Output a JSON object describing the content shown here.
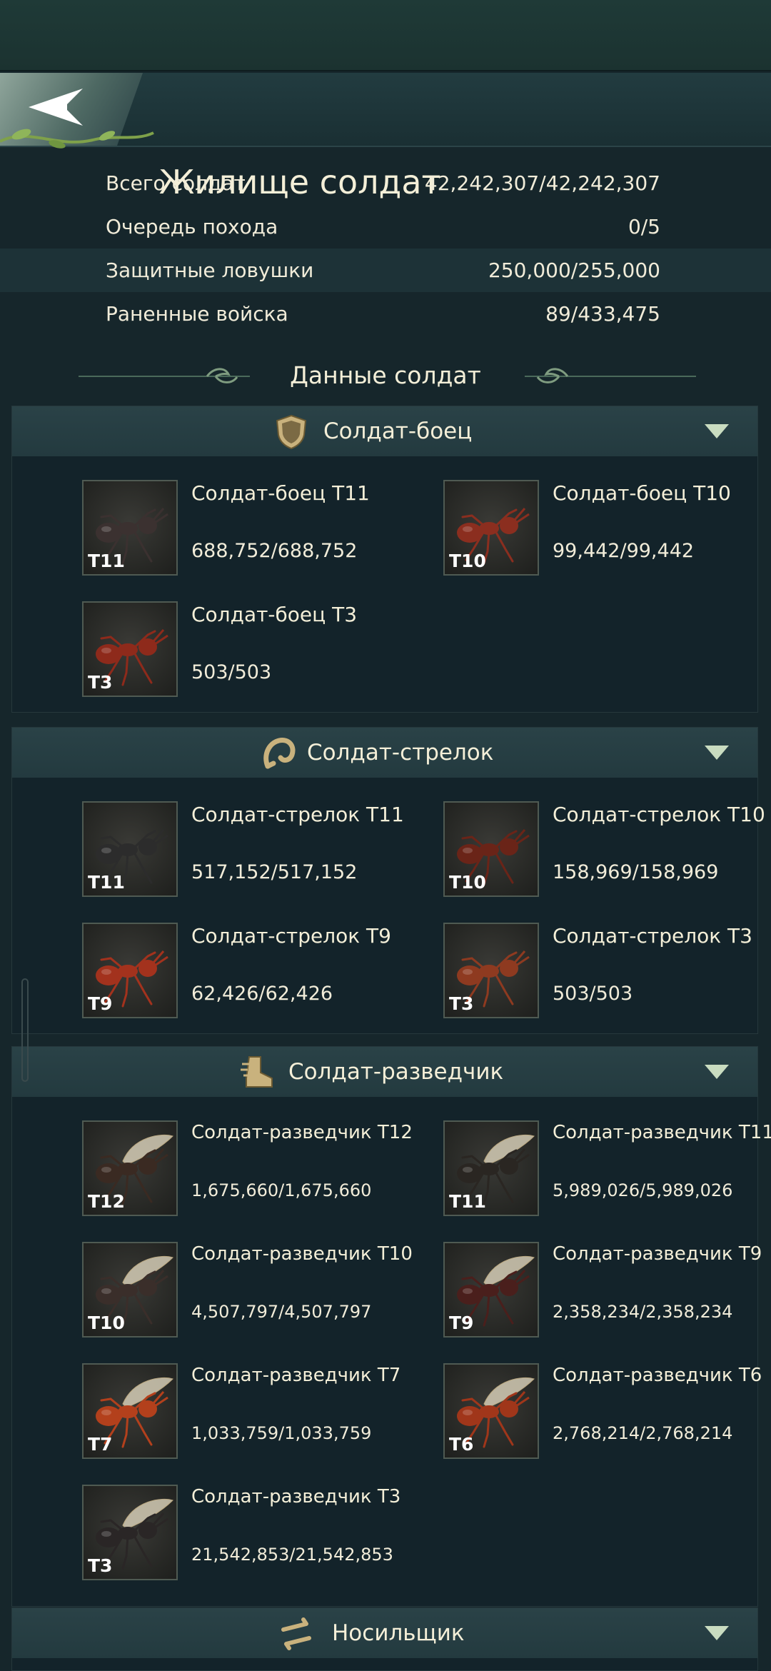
{
  "header": {
    "title": "Жилище солдат"
  },
  "stats": [
    {
      "label": "Всего солдат",
      "value": "42,242,307/42,242,307"
    },
    {
      "label": "Очередь похода",
      "value": "0/5"
    },
    {
      "label": "Защитные ловушки",
      "value": "250,000/255,000"
    },
    {
      "label": "Раненные войска",
      "value": "89/433,475"
    }
  ],
  "section_title": "Данные солдат",
  "sections": [
    {
      "title": "Солдат-боец",
      "icon": "shield-icon",
      "units": [
        {
          "name": "Солдат-боец T11",
          "count": "688,752/688,752",
          "tier": "T11",
          "color": "#3b3130"
        },
        {
          "name": "Солдат-боец T10",
          "count": "99,442/99,442",
          "tier": "T10",
          "color": "#8b2e1f"
        },
        {
          "name": "Солдат-боец T3",
          "count": "503/503",
          "tier": "T3",
          "color": "#8e2a1b"
        }
      ]
    },
    {
      "title": "Солдат-стрелок",
      "icon": "spiral-icon",
      "units": [
        {
          "name": "Солдат-стрелок T11",
          "count": "517,152/517,152",
          "tier": "T11",
          "color": "#2c2c2c"
        },
        {
          "name": "Солдат-стрелок T10",
          "count": "158,969/158,969",
          "tier": "T10",
          "color": "#6a2418"
        },
        {
          "name": "Солдат-стрелок T9",
          "count": "62,426/62,426",
          "tier": "T9",
          "color": "#a3321d"
        },
        {
          "name": "Солдат-стрелок T3",
          "count": "503/503",
          "tier": "T3",
          "color": "#8e3a20"
        }
      ]
    },
    {
      "title": "Солдат-разведчик",
      "icon": "boot-icon",
      "units": [
        {
          "name": "Солдат-разведчик T12",
          "count": "1,675,660/1,675,660",
          "tier": "T12",
          "color": "#3a2a22"
        },
        {
          "name": "Солдат-разведчик T11",
          "count": "5,989,026/5,989,026",
          "tier": "T11",
          "color": "#2a2622"
        },
        {
          "name": "Солдат-разведчик T10",
          "count": "4,507,797/4,507,797",
          "tier": "T10",
          "color": "#3a2e2a"
        },
        {
          "name": "Солдат-разведчик T9",
          "count": "2,358,234/2,358,234",
          "tier": "T9",
          "color": "#4a1f1c"
        },
        {
          "name": "Солдат-разведчик T7",
          "count": "1,033,759/1,033,759",
          "tier": "T7",
          "color": "#b3401c"
        },
        {
          "name": "Солдат-разведчик T6",
          "count": "2,768,214/2,768,214",
          "tier": "T6",
          "color": "#a0361a"
        },
        {
          "name": "Солдат-разведчик T3",
          "count": "21,542,853/21,542,853",
          "tier": "T3",
          "color": "#2a2626"
        }
      ]
    },
    {
      "title": "Носильщик",
      "icon": "carrier-icon",
      "units": []
    }
  ]
}
